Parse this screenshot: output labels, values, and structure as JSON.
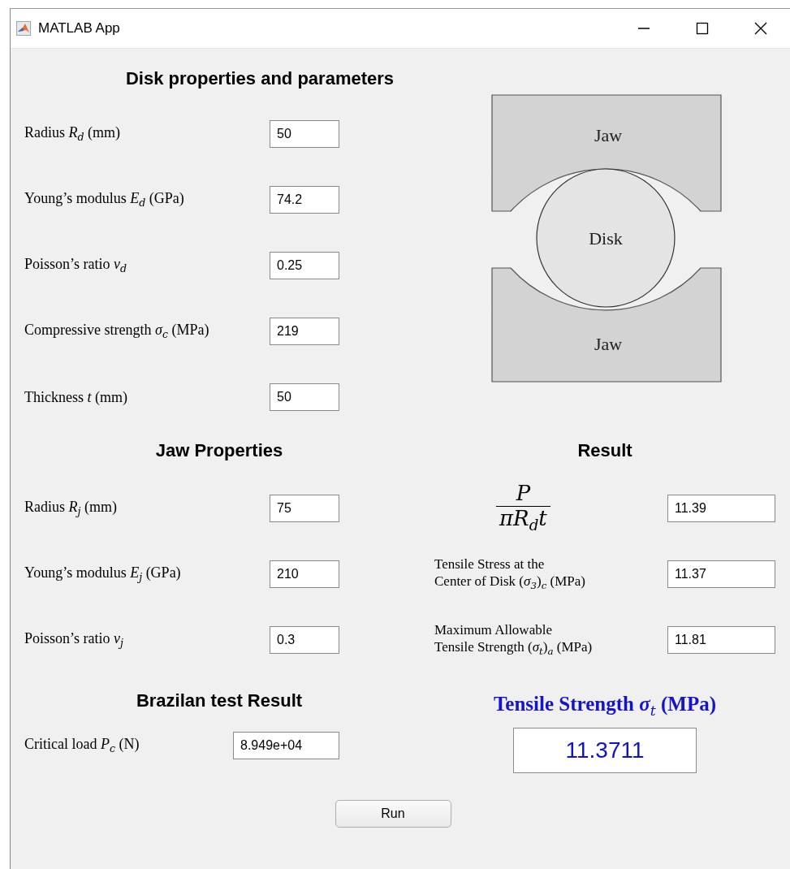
{
  "window": {
    "title": "MATLAB App"
  },
  "disk": {
    "heading": "Disk properties and parameters",
    "fields": [
      {
        "label": "Radius *R*$_{d}$ (mm)",
        "value": "50"
      },
      {
        "label": "Young’s modulus *E*$_{d}$ (GPa)",
        "value": "74.2"
      },
      {
        "label": "Poisson’s ratio *ν*$_{d}$",
        "value": "0.25"
      },
      {
        "label": "Compressive strength *σ*$_{c}$ (MPa)",
        "value": "219"
      },
      {
        "label": "Thickness *t* (mm)",
        "value": "50"
      }
    ]
  },
  "diagram": {
    "jaw_top": "Jaw",
    "disk": "Disk",
    "jaw_bottom": "Jaw"
  },
  "jaw": {
    "heading": "Jaw Properties",
    "fields": [
      {
        "label": "Radius *R*$_{j}$ (mm)",
        "value": "75"
      },
      {
        "label": "Young’s modulus *E*$_{j}$ (GPa)",
        "value": "210"
      },
      {
        "label": "Poisson’s ratio *ν*$_{j}$",
        "value": "0.3"
      }
    ]
  },
  "result": {
    "heading": "Result",
    "rows": [
      {
        "kind": "formula",
        "numerator": "P",
        "denominator": "πR$_{d}$t",
        "value": "11.39"
      },
      {
        "kind": "text",
        "label": "Tensile Stress at the\nCenter of Disk (*σ*$_{3}$)$_{c}$ (MPa)",
        "value": "11.37"
      },
      {
        "kind": "text",
        "label": "Maximum Allowable\nTensile Strength (*σ*$_{t}$)$_{a}$ (MPa)",
        "value": "11.81"
      }
    ]
  },
  "brazilian": {
    "heading": "Brazilan test Result",
    "fields": [
      {
        "label": "Critical load *P*$_{c}$ (N)",
        "value": "8.949e+04"
      }
    ]
  },
  "tensile_strength": {
    "heading": "**Tensile Strength** *σ*$_{t}$ **(MPa)**",
    "value": "11.3711"
  },
  "run_button": {
    "label": "Run"
  }
}
